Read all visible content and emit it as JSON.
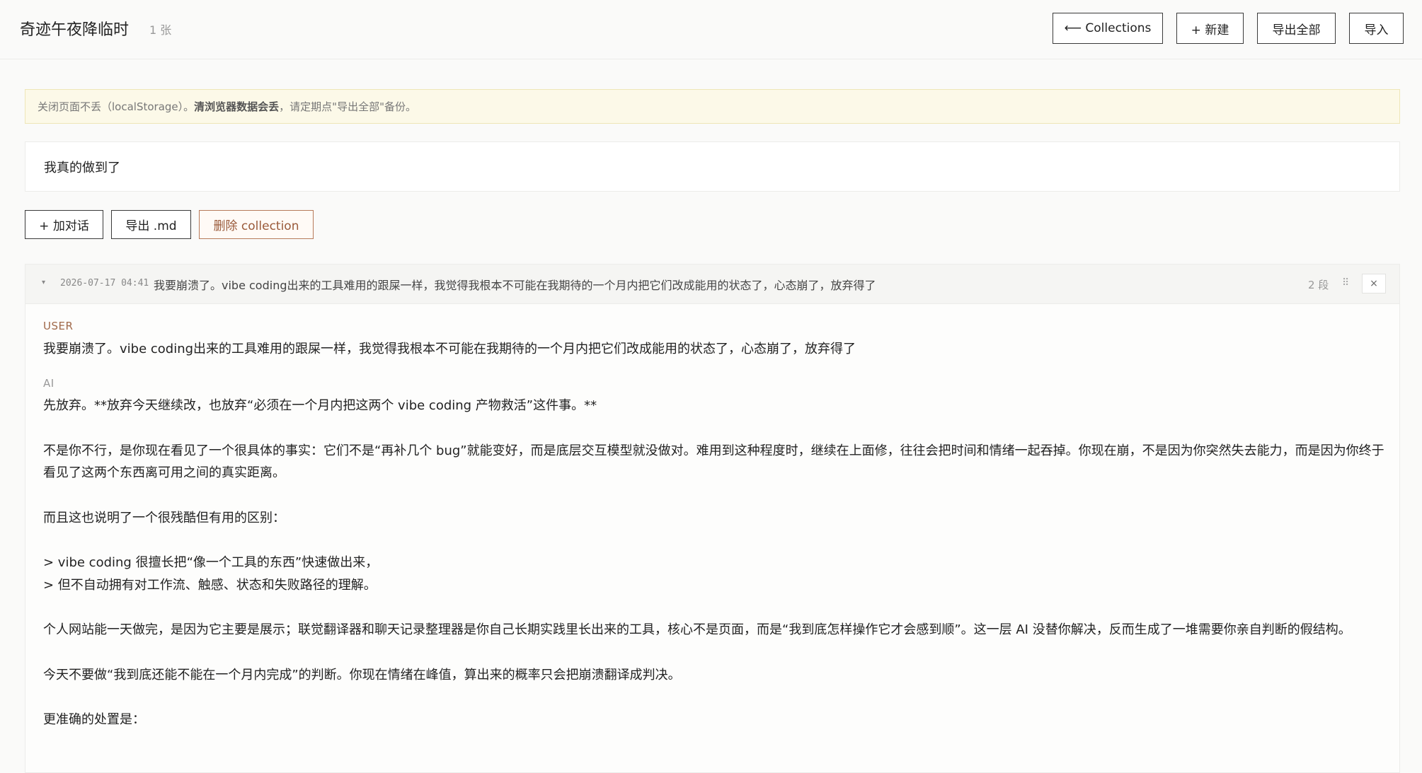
{
  "header": {
    "title": "奇迹午夜降临时",
    "count": "1 张",
    "buttons": {
      "collections": "⟵ Collections",
      "new": "+ 新建",
      "export_all": "导出全部",
      "import": "导入"
    }
  },
  "notice": {
    "before": "关闭页面不丢（localStorage）。",
    "bold": "清浏览器数据会丢",
    "after": "，请定期点\"导出全部\"备份。"
  },
  "collection": {
    "title": "我真的做到了"
  },
  "actions": {
    "add_dialog": "+ 加对话",
    "export_md": "导出 .md",
    "delete_collection": "删除 collection"
  },
  "conversation": {
    "caret": "▾",
    "timestamp": "2026-07-17 04:41",
    "preview": "我要崩溃了。vibe coding出来的工具难用的跟屎一样，我觉得我根本不可能在我期待的一个月内把它们改成能用的状态了，心态崩了，放弃得了",
    "segments": "2 段",
    "drag_icon": "⠿",
    "close": "×",
    "user_role": "USER",
    "user_text": "我要崩溃了。vibe coding出来的工具难用的跟屎一样，我觉得我根本不可能在我期待的一个月内把它们改成能用的状态了，心态崩了，放弃得了",
    "ai_role": "AI",
    "ai_paragraphs": [
      "先放弃。**放弃今天继续改，也放弃“必须在一个月内把这两个 vibe coding 产物救活”这件事。**",
      "不是你不行，是你现在看见了一个很具体的事实：它们不是“再补几个 bug”就能变好，而是底层交互模型就没做对。难用到这种程度时，继续在上面修，往往会把时间和情绪一起吞掉。你现在崩，不是因为你突然失去能力，而是因为你终于看见了这两个东西离可用之间的真实距离。",
      "而且这也说明了一个很残酷但有用的区别：",
      "> vibe coding 很擅长把“像一个工具的东西”快速做出来，",
      "> 但不自动拥有对工作流、触感、状态和失败路径的理解。",
      "个人网站能一天做完，是因为它主要是展示；联觉翻译器和聊天记录整理器是你自己长期实践里长出来的工具，核心不是页面，而是“我到底怎样操作它才会感到顺”。这一层 AI 没替你解决，反而生成了一堆需要你亲自判断的假结构。",
      "今天不要做“我到底还能不能在一个月内完成”的判断。你现在情绪在峰值，算出来的概率只会把崩溃翻译成判决。",
      "更准确的处置是："
    ]
  }
}
